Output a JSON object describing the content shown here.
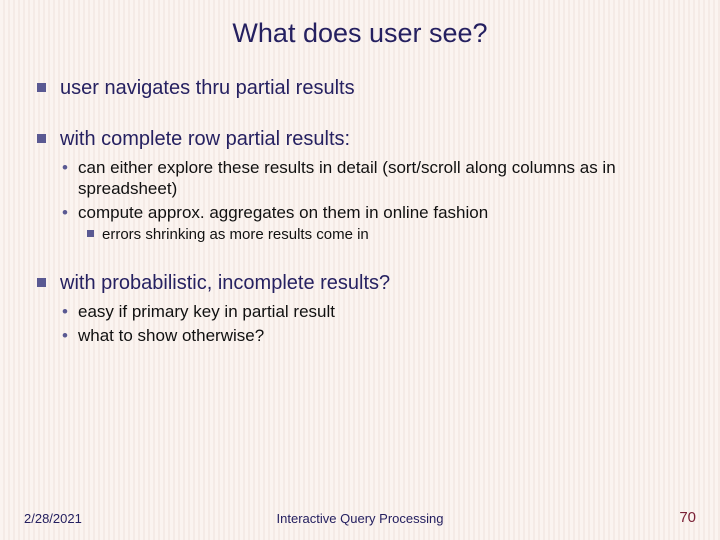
{
  "title": "What does user see?",
  "bullets": {
    "b1": "user navigates thru partial results",
    "b2": "with complete row partial results:",
    "b2_1": "can either explore these results in detail (sort/scroll along columns as in spreadsheet)",
    "b2_2": "compute approx. aggregates on them in online fashion",
    "b2_2_1": "errors shrinking as more results come in",
    "b3": "with probabilistic, incomplete results?",
    "b3_1": "easy if primary key in partial result",
    "b3_2": "what to show otherwise?"
  },
  "footer": {
    "date": "2/28/2021",
    "title": "Interactive Query Processing",
    "pageNumber": "70"
  }
}
